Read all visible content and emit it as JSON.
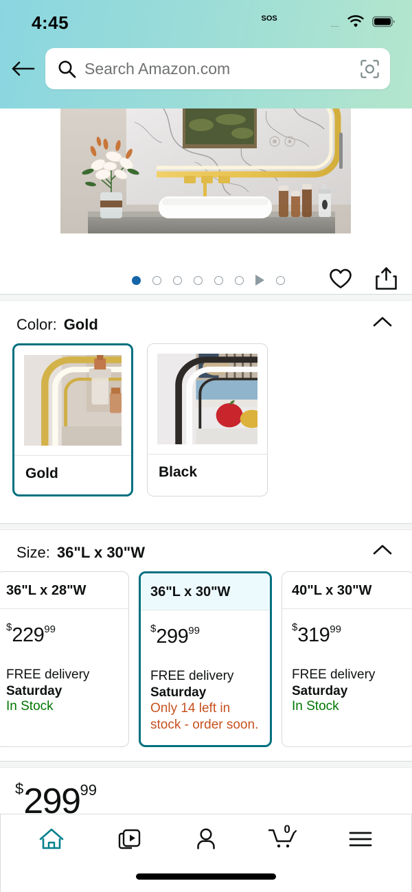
{
  "status_bar": {
    "time": "4:45",
    "sos_label": "SOS",
    "sos_dots": "....",
    "wifi_icon": "wifi-icon",
    "battery_icon": "battery-icon"
  },
  "header": {
    "back_icon": "back-arrow-icon",
    "search": {
      "placeholder": "Search Amazon.com",
      "value": "",
      "search_icon": "search-icon",
      "lens_icon": "camera-lens-icon"
    },
    "gradient_from": "#8ad6e0",
    "gradient_to": "#b4e6cd"
  },
  "gallery": {
    "image_alt": "bathroom vanity with gold framed LED mirror, lily bouquet, white vessel sink",
    "dots": [
      {
        "active": true
      },
      {
        "active": false
      },
      {
        "active": false
      },
      {
        "active": false
      },
      {
        "active": false
      },
      {
        "active": false
      }
    ],
    "play_icon": "play-triangle-icon",
    "video_dot": {
      "active": false
    },
    "active_dot_color": "#1565a8",
    "favorite_icon": "heart-icon",
    "share_icon": "share-icon"
  },
  "color_section": {
    "label": "Color:",
    "value": "Gold",
    "collapse_icon": "chevron-up-icon",
    "options": [
      {
        "name": "Gold",
        "selected": true
      },
      {
        "name": "Black",
        "selected": false
      }
    ]
  },
  "size_section": {
    "label": "Size:",
    "value": "36\"L x 30\"W",
    "collapse_icon": "chevron-up-icon",
    "options": [
      {
        "title": "36\"L x 28\"W",
        "price_symbol": "$",
        "price_int": "229",
        "price_frac": "99",
        "delivery_line": "FREE delivery",
        "delivery_day": "Saturday",
        "stock_text": "In Stock",
        "stock_state": "in-stock",
        "selected": false
      },
      {
        "title": "36\"L x 30\"W",
        "price_symbol": "$",
        "price_int": "299",
        "price_frac": "99",
        "delivery_line": "FREE delivery",
        "delivery_day": "Saturday",
        "stock_text": "Only 14 left in stock - order soon.",
        "stock_state": "low-stock",
        "selected": true
      },
      {
        "title": "40\"L x 30\"W",
        "price_symbol": "$",
        "price_int": "319",
        "price_frac": "99",
        "delivery_line": "FREE delivery",
        "delivery_day": "Saturday",
        "stock_text": "In Stock",
        "stock_state": "in-stock",
        "selected": false
      }
    ],
    "selected_border_color": "#00707f",
    "in_stock_color": "#007600",
    "low_stock_color": "#c7511f"
  },
  "price_block": {
    "symbol": "$",
    "integer": "299",
    "fraction": "99"
  },
  "bottom_nav": {
    "items": [
      {
        "name": "home",
        "icon": "home-icon",
        "active": true
      },
      {
        "name": "inspire",
        "icon": "video-feed-icon",
        "active": false
      },
      {
        "name": "account",
        "icon": "person-icon",
        "active": false
      },
      {
        "name": "cart",
        "icon": "cart-icon",
        "active": false,
        "badge": "0"
      },
      {
        "name": "menu",
        "icon": "hamburger-menu-icon",
        "active": false
      }
    ],
    "active_color": "#007f8c",
    "home_indicator": "home-indicator"
  }
}
